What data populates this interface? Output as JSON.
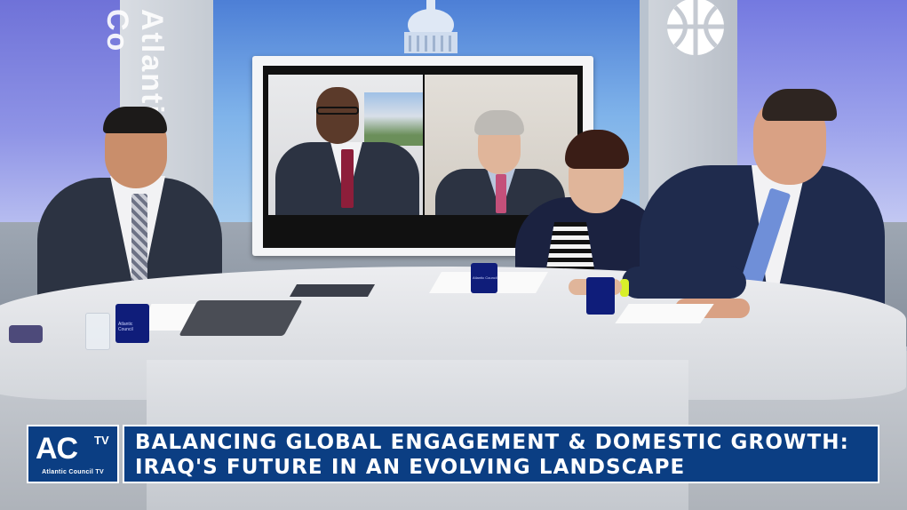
{
  "studio": {
    "backdrop_text": "Atlantic Co"
  },
  "lower_third": {
    "logo_main": "AC",
    "logo_tv": "TV",
    "logo_subtitle": "Atlantic Council TV",
    "headline_line1": "BALANCING GLOBAL ENGAGEMENT & DOMESTIC GROWTH:",
    "headline_line2": "IRAQ'S FUTURE IN AN EVOLVING LANDSCAPE"
  },
  "mug_label": "Atlantic Council",
  "colors": {
    "brand_blue": "#0b3e83",
    "mug_blue": "#0f1d7a"
  }
}
